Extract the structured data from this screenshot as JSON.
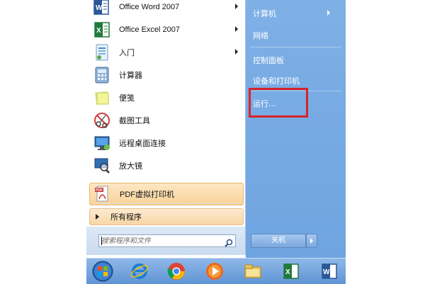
{
  "start_menu": {
    "programs": [
      {
        "label": "Office Word 2007",
        "icon": "word-icon",
        "has_submenu": true
      },
      {
        "label": "Office Excel 2007",
        "icon": "excel-icon",
        "has_submenu": true
      },
      {
        "label": "入门",
        "icon": "getting-started-icon",
        "has_submenu": true
      },
      {
        "label": "计算器",
        "icon": "calculator-icon",
        "has_submenu": false
      },
      {
        "label": "便笺",
        "icon": "sticky-notes-icon",
        "has_submenu": false
      },
      {
        "label": "截图工具",
        "icon": "snipping-tool-icon",
        "has_submenu": false
      },
      {
        "label": "远程桌面连接",
        "icon": "remote-desktop-icon",
        "has_submenu": false
      },
      {
        "label": "放大镜",
        "icon": "magnifier-icon",
        "has_submenu": false
      },
      {
        "label": "PDF虚拟打印机",
        "icon": "pdf-printer-icon",
        "has_submenu": false,
        "highlighted": true
      }
    ],
    "all_programs_label": "所有程序",
    "search": {
      "placeholder": "搜索程序和文件",
      "icon": "search-icon"
    },
    "right_links": [
      {
        "label": "计算机",
        "has_submenu": true
      },
      {
        "label": "网络",
        "has_submenu": false
      },
      {
        "label": "控制面板",
        "has_submenu": false
      },
      {
        "label": "设备和打印机",
        "has_submenu": false
      },
      {
        "label": "运行...",
        "has_submenu": false,
        "annotated": true
      }
    ],
    "shutdown_label": "关机",
    "annotation_color": "#d8232a"
  },
  "taskbar": {
    "items": [
      "start-orb-icon",
      "internet-explorer-icon",
      "chrome-icon",
      "media-player-icon",
      "file-explorer-icon",
      "excel-icon",
      "word-icon"
    ]
  },
  "colors": {
    "right_pane": "#74a8e2",
    "taskbar": "#6f9fd9",
    "highlight_item": "#fbddb0"
  }
}
